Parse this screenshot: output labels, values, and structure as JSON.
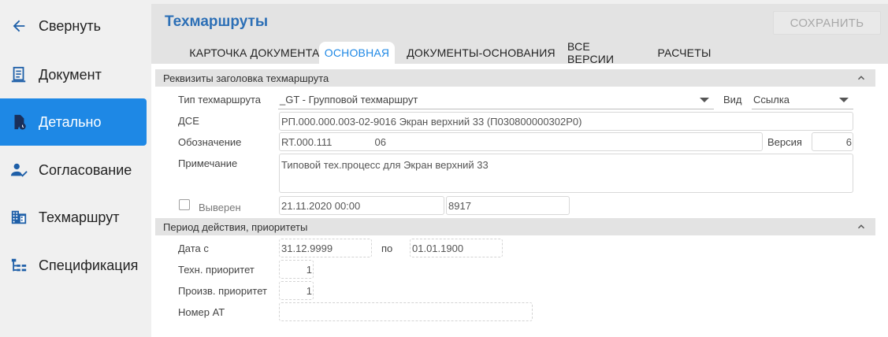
{
  "sidebar": {
    "items": [
      {
        "label": "Свернуть",
        "icon": "arrow-left-icon"
      },
      {
        "label": "Документ",
        "icon": "document-icon"
      },
      {
        "label": "Детально",
        "icon": "file-clock-icon",
        "active": true
      },
      {
        "label": "Согласование",
        "icon": "user-check-icon"
      },
      {
        "label": "Техмаршрут",
        "icon": "building-icon"
      },
      {
        "label": "Спецификация",
        "icon": "tree-list-icon"
      }
    ],
    "active_color": "#1e88e5"
  },
  "header": {
    "title": "Техмаршруты",
    "save_label": "СОХРАНИТЬ",
    "tabs": [
      {
        "label": "КАРТОЧКА ДОКУМЕНТА"
      },
      {
        "label": "ОСНОВНАЯ",
        "active": true
      },
      {
        "label": "ДОКУМЕНТЫ-ОСНОВАНИЯ"
      },
      {
        "label": "ВСЕ ВЕРСИИ"
      },
      {
        "label": "РАСЧЕТЫ"
      }
    ]
  },
  "section1": {
    "title": "Реквизиты заголовка техмаршрута",
    "type_label": "Тип техмаршрута",
    "type_value": "_GT - Групповой техмаршрут",
    "kind_label": "Вид",
    "kind_value": "Ссылка",
    "dse_label": "ДСЕ",
    "dse_value": "РП.000.000.003-02-9016 Экран верхний 33 (П030800000302Р0)",
    "designation_label": "Обозначение",
    "designation_value": "RT.000.111               06",
    "version_label": "Версия",
    "version_value": "6",
    "note_label": "Примечание",
    "note_value": "Типовой тех.процесс для Экран верхний 33",
    "verified_label": "Выверен",
    "verified_date": "21.11.2020 00:00",
    "verified_code": "8917"
  },
  "section2": {
    "title": "Период действия, приоритеты",
    "date_from_label": "Дата с",
    "date_from_value": "31.12.9999",
    "date_to_label": "по",
    "date_to_value": "01.01.1900",
    "tech_priority_label": "Техн. приоритет",
    "tech_priority_value": "1",
    "prod_priority_label": "Произв. приоритет",
    "prod_priority_value": "1",
    "at_number_label": "Номер АТ",
    "at_number_value": ""
  }
}
